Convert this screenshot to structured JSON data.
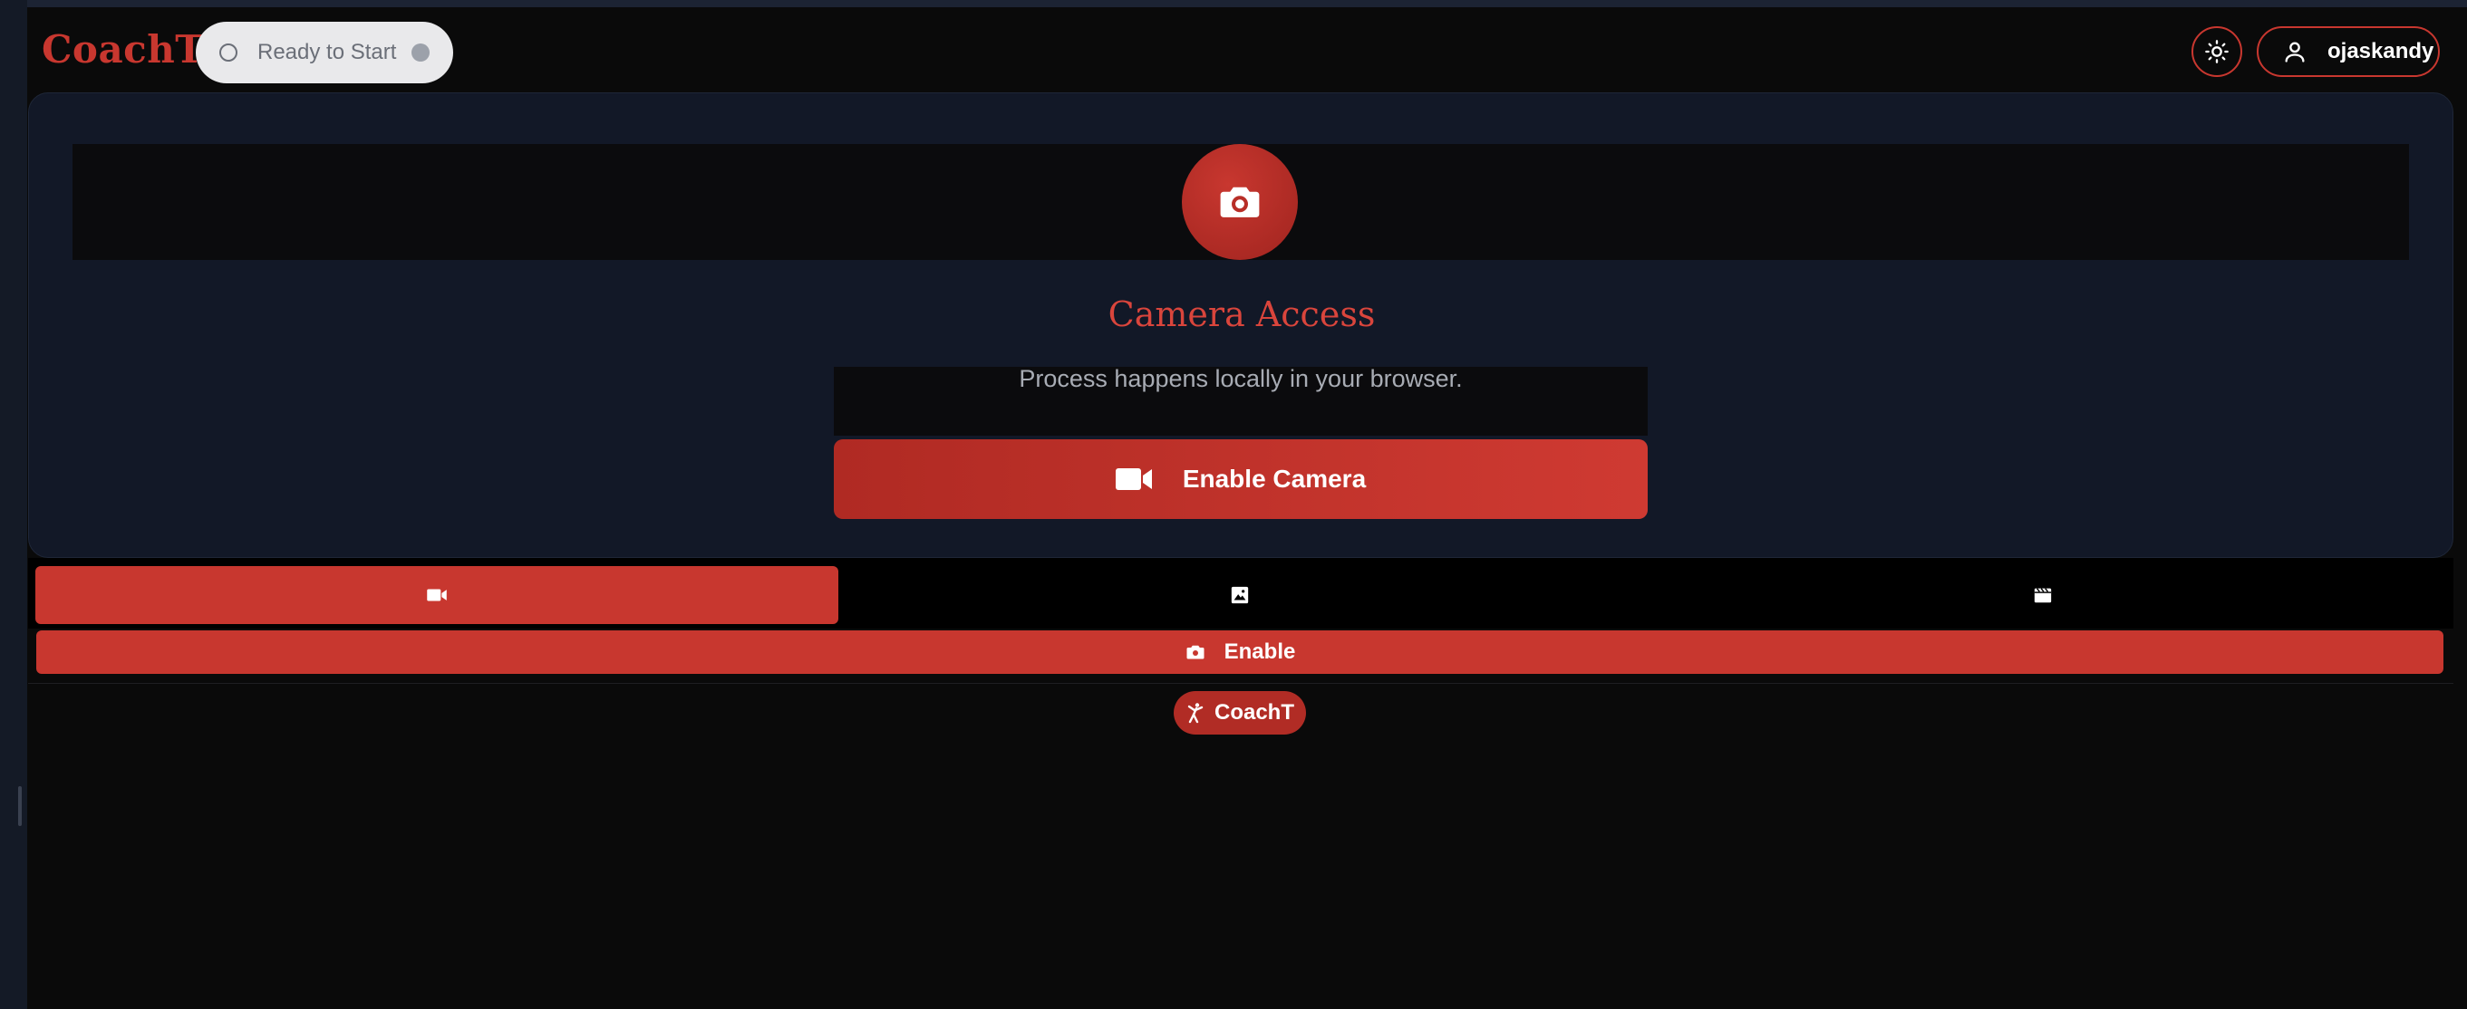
{
  "header": {
    "logo": "CoachT",
    "status": {
      "label": "Ready to Start",
      "dot_color": "#9ca1aa"
    },
    "theme_toggle_icon": "sun-icon",
    "user": {
      "name": "ojaskandy",
      "icon": "user-icon"
    }
  },
  "camera_card": {
    "icon": "camera-icon",
    "title": "Camera Access",
    "subtitle": "Process happens locally in your browser.",
    "enable_button": {
      "label": "Enable Camera",
      "icon": "video-camera-icon"
    }
  },
  "mode_tabs": [
    {
      "icon": "video-camera-icon",
      "active": true
    },
    {
      "icon": "image-icon",
      "active": false
    },
    {
      "icon": "film-icon",
      "active": false
    }
  ],
  "enable_bar": {
    "label": "Enable",
    "icon": "camera-icon"
  },
  "footer_badge": {
    "label": "CoachT",
    "icon": "martial-arts-icon"
  },
  "colors": {
    "accent": "#c8372f",
    "background": "#0a0a0a",
    "card_background": "#121827",
    "status_pill": "#e9e9eb"
  }
}
